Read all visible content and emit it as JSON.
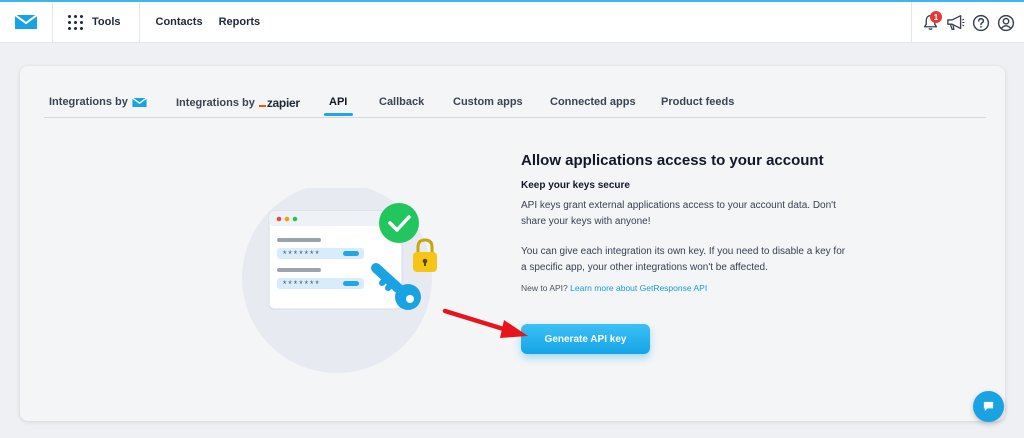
{
  "topbar": {
    "tools_label": "Tools",
    "nav": [
      "Contacts",
      "Reports"
    ],
    "notification_count": "1",
    "icons": [
      "envelope-logo-icon",
      "grid-icon",
      "bell-icon",
      "megaphone-icon",
      "help-icon",
      "account-icon"
    ]
  },
  "tabs": {
    "integrations_by": "Integrations by",
    "integrations_by_zapier": "Integrations by",
    "zapier_brand": "zapier",
    "api": "API",
    "callback": "Callback",
    "custom_apps": "Custom apps",
    "connected_apps": "Connected apps",
    "product_feeds": "Product feeds",
    "active": "API"
  },
  "main": {
    "heading": "Allow applications access to your account",
    "subheading": "Keep your keys secure",
    "para1": "API keys grant external applications access to your account data. Don't share your keys with anyone!",
    "para2": "You can give each integration its own key. If you need to disable a key for a specific app, your other integrations won't be affected.",
    "new_to_api": "New to API?",
    "learn_more_link": "Learn more about GetResponse API",
    "generate_button": "Generate API key"
  },
  "illustration": {
    "masked_key_1": "*******",
    "masked_key_2": "*******"
  },
  "colors": {
    "accent": "#14a5e6",
    "arrow": "#e8141b",
    "check": "#22c55e",
    "lock": "#f5c518"
  }
}
